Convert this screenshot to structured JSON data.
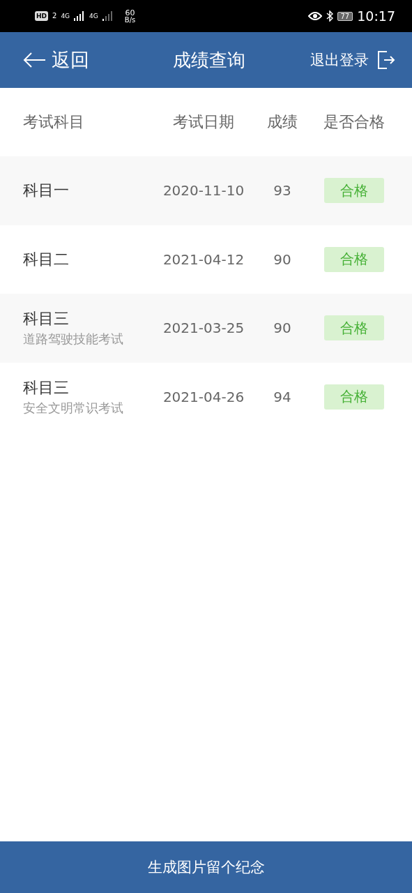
{
  "status_bar": {
    "hd": "HD",
    "sim": "2",
    "net1": "4G",
    "net2": "4G",
    "speed": "60",
    "speed_unit": "B/s",
    "battery": "77",
    "time": "10:17"
  },
  "header": {
    "back": "返回",
    "title": "成绩查询",
    "logout": "退出登录"
  },
  "table": {
    "columns": [
      "考试科目",
      "考试日期",
      "成绩",
      "是否合格"
    ],
    "rows": [
      {
        "subject": "科目一",
        "date": "2020-11-10",
        "score": "93",
        "result": "合格",
        "passed": true
      },
      {
        "subject": "科目二",
        "date": "2021-04-12",
        "score": "90",
        "result": "合格",
        "passed": true
      },
      {
        "subject": "科目三",
        "note": "道路驾驶技能考试",
        "date": "2021-03-25",
        "score": "90",
        "result": "合格",
        "passed": true
      },
      {
        "subject": "科目三",
        "note": "安全文明常识考试",
        "date": "2021-04-26",
        "score": "94",
        "result": "合格",
        "passed": true
      }
    ]
  },
  "footer_button": "生成图片留个纪念"
}
